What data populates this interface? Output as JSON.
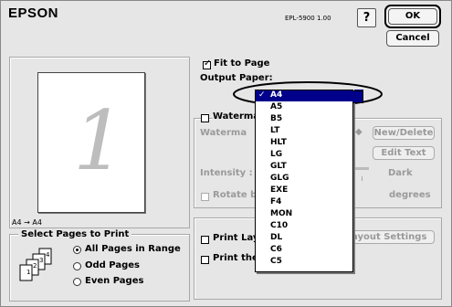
{
  "header": {
    "brand": "EPSON",
    "model": "EPL-5900  1.00",
    "help": "?",
    "ok_label": "OK",
    "cancel_label": "Cancel"
  },
  "preview": {
    "page_number": "1",
    "caption": "A4 → A4"
  },
  "fit": {
    "label": "Fit to Page",
    "checked": true,
    "output_paper_label": "Output Paper:"
  },
  "watermark": {
    "label": "Waterma",
    "field_label": "Waterma",
    "new_delete": "New/Delete",
    "edit_text": "Edit Text",
    "intensity_label": "Intensity :",
    "intensity_value": "Dark",
    "rotate_label": "Rotate by",
    "degrees": "degrees"
  },
  "layout": {
    "print_layout": "Print Lay",
    "print_the": "Print the",
    "layout_settings": "ayout Settings"
  },
  "select_pages": {
    "title": "Select Pages to Print",
    "options": [
      "All Pages in Range",
      "Odd Pages",
      "Even Pages"
    ],
    "selected_index": 0
  },
  "paper_menu": {
    "selected": "A4",
    "items": [
      "A4",
      "A5",
      "B5",
      "LT",
      "HLT",
      "LG",
      "GLT",
      "GLG",
      "EXE",
      "F4",
      "MON",
      "C10",
      "DL",
      "C6",
      "C5"
    ]
  }
}
